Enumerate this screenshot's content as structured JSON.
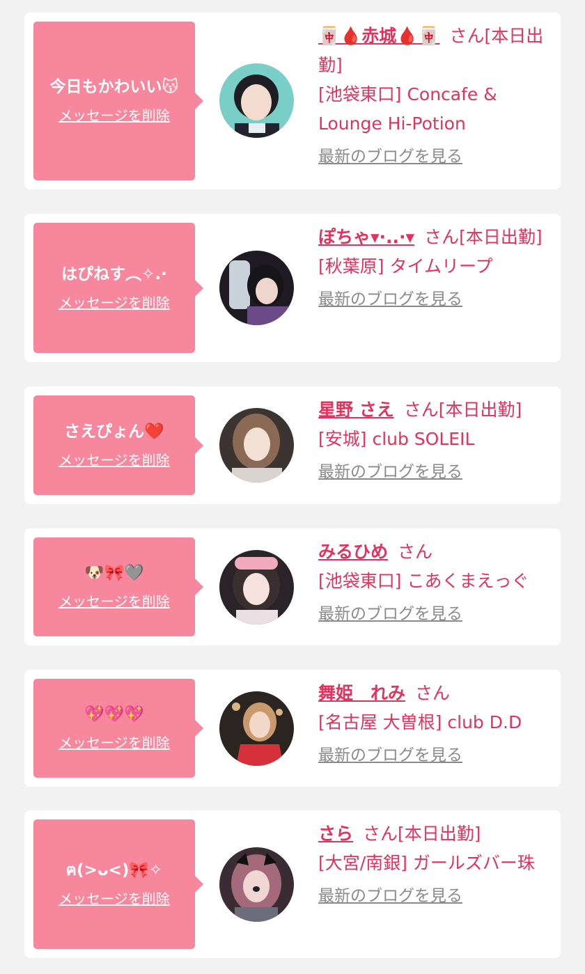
{
  "colors": {
    "accent": "#e0345e",
    "bubble": "#f7879c",
    "muted": "#8a8a8a",
    "background": "#f2f2f2"
  },
  "cards": [
    {
      "message": "今日もかわいい😽",
      "delete_label": "メッセージを削除",
      "name": "🀄🩸赤城🩸🀄",
      "honorific": "さん[本日出勤]",
      "shop": "[池袋東口] Concafe & Lounge Hi-Potion",
      "blog_label": "最新のブログを見る"
    },
    {
      "message": "はぴねす︵✧.·",
      "delete_label": "メッセージを削除",
      "name": "ぽちゃ▾·..·▾",
      "honorific": "さん[本日出勤]",
      "shop": "[秋葉原] タイムリープ",
      "blog_label": "最新のブログを見る"
    },
    {
      "message": "さえぴょん❤️",
      "delete_label": "メッセージを削除",
      "name": "星野 さえ",
      "honorific": "さん[本日出勤]",
      "shop": "[安城] club SOLEIL",
      "blog_label": "最新のブログを見る"
    },
    {
      "message": "🐶🎀🩶",
      "delete_label": "メッセージを削除",
      "name": "みるひめ",
      "honorific": "さん",
      "shop": "[池袋東口] こあくまえっぐ",
      "blog_label": "最新のブログを見る"
    },
    {
      "message": "💖💖💖",
      "delete_label": "メッセージを削除",
      "name": "舞姫　れみ",
      "honorific": "さん",
      "shop": "[名古屋 大曽根] club D.D",
      "blog_label": "最新のブログを見る"
    },
    {
      "message": "ฅ(>ᴗ<)🎀✧",
      "delete_label": "メッセージを削除",
      "name": "さら",
      "honorific": "さん[本日出勤]",
      "shop": "[大宮/南銀] ガールズバー珠",
      "blog_label": "最新のブログを見る"
    }
  ]
}
